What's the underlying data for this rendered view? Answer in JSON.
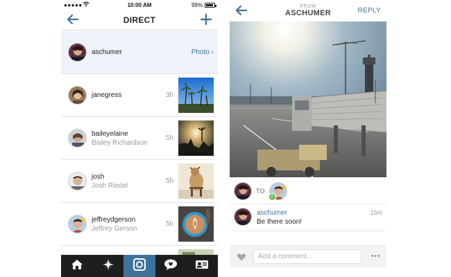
{
  "left_screen": {
    "status_bar": {
      "signal": "●●●●●",
      "time": "10:00 AM",
      "battery": "99%"
    },
    "nav": {
      "title": "DIRECT"
    },
    "threads": [
      {
        "username": "aschumer",
        "full_name": "",
        "time": "",
        "action": "Photo ›"
      },
      {
        "username": "janegress",
        "full_name": "",
        "time": "3h",
        "action": ""
      },
      {
        "username": "baileyelaine",
        "full_name": "Bailey Richardson",
        "time": "5h",
        "action": ""
      },
      {
        "username": "josh",
        "full_name": "Josh Riedel",
        "time": "5h",
        "action": ""
      },
      {
        "username": "jeffreydgerson",
        "full_name": "Jeffrey Gerson",
        "time": "5h",
        "action": ""
      }
    ],
    "tabs": [
      {
        "icon": "home-icon"
      },
      {
        "icon": "explore-icon"
      },
      {
        "icon": "camera-icon",
        "active": true
      },
      {
        "icon": "activity-icon"
      },
      {
        "icon": "profile-icon"
      }
    ]
  },
  "right_screen": {
    "header": {
      "from_label": "FROM",
      "from_user": "ASCHUMER",
      "reply_label": "REPLY"
    },
    "to_label": "TO",
    "comment": {
      "username": "aschumer",
      "text": "Be there soon!",
      "time": "15m"
    },
    "comment_input": {
      "placeholder": "Add a comment…",
      "value": ""
    },
    "more_label": "•••"
  },
  "colors": {
    "accent": "#3f729b",
    "tabbar_bg": "#1e1e1e",
    "selected_row_bg": "#eef3fa"
  }
}
